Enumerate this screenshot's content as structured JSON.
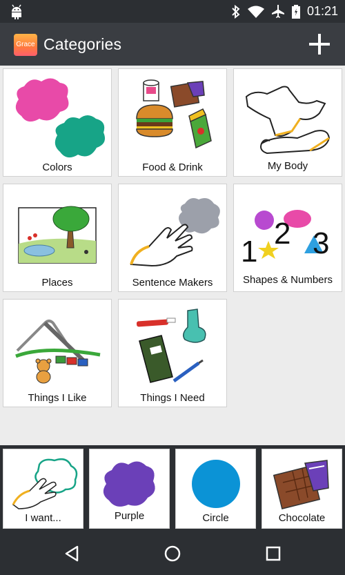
{
  "status": {
    "time": "01:21",
    "icons": [
      "android-icon",
      "bluetooth-icon",
      "wifi-icon",
      "airplane-icon",
      "battery-icon"
    ]
  },
  "app": {
    "logo_text": "Grace",
    "title": "Categories",
    "add_icon": "plus-icon"
  },
  "categories": [
    {
      "label": "Colors"
    },
    {
      "label": "Food & Drink"
    },
    {
      "label": "My Body"
    },
    {
      "label": "Places"
    },
    {
      "label": "Sentence Makers"
    },
    {
      "label": "Shapes & Numbers",
      "digits": [
        "1",
        "2",
        "3"
      ]
    },
    {
      "label": "Things I Like"
    },
    {
      "label": "Things I Need"
    }
  ],
  "sentence": [
    {
      "label": "I want..."
    },
    {
      "label": "Purple"
    },
    {
      "label": "Circle"
    },
    {
      "label": "Chocolate"
    }
  ],
  "colors": {
    "pink": "#e84aa8",
    "teal": "#17a487",
    "purple": "#6b40b8",
    "blue": "#0b93d6",
    "bar": "#2c2f33",
    "appbar": "#3a3d42"
  }
}
